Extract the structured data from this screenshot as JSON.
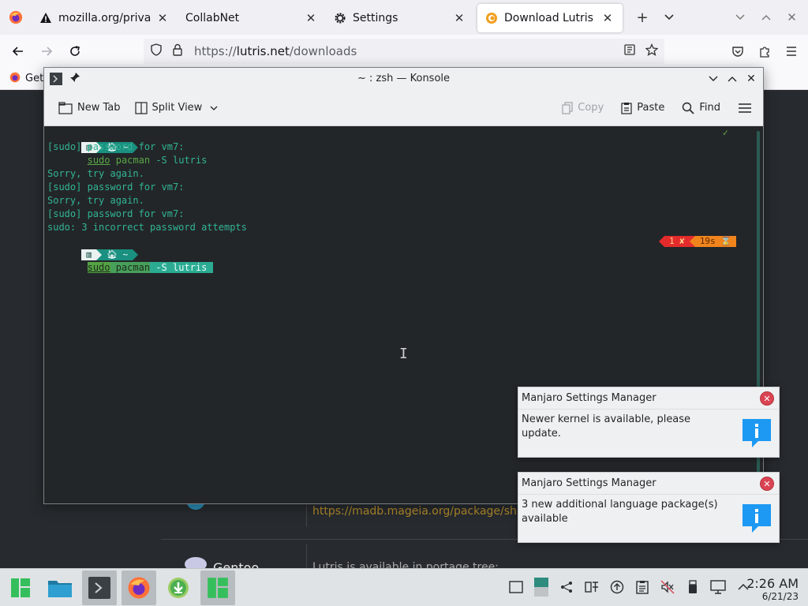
{
  "browser": {
    "tabs": [
      {
        "label": "mozilla.org/privacy/fi",
        "icon": "warning-icon"
      },
      {
        "label": "CollabNet",
        "icon": ""
      },
      {
        "label": "Settings",
        "icon": "gear-icon"
      },
      {
        "label": "Download Lutris",
        "icon": "lutris-icon",
        "active": true
      }
    ],
    "url_prefix": "https://",
    "url_host": "lutris.net",
    "url_path": "/downloads",
    "bookmark_label": "Get"
  },
  "webpage": {
    "mageia_link": "https://madb.mageia.org/package/sh",
    "gentoo_name": "Gentoo",
    "gentoo_desc": "Lutris is available in portage tree:"
  },
  "konsole": {
    "title": "~ : zsh — Konsole",
    "toolbar": {
      "new_tab": "New Tab",
      "split_view": "Split View",
      "copy": "Copy",
      "paste": "Paste",
      "find": "Find"
    },
    "terminal": {
      "cmd_sudo": "sudo",
      "cmd_pacman": "pacman",
      "cmd_rest": " -S lutris",
      "prompt_home": "~",
      "lines": [
        "[sudo] password for vm7:",
        "",
        "Sorry, try again.",
        "[sudo] password for vm7:",
        "Sorry, try again.",
        "[sudo] password for vm7:",
        "sudo: 3 incorrect password attempts"
      ],
      "rprompt_err": "1 ✘",
      "rprompt_time": "19s ⌛",
      "check": "✓"
    }
  },
  "notifications": [
    {
      "app": "Manjaro Settings Manager",
      "message": "Newer kernel is available, please update."
    },
    {
      "app": "Manjaro Settings Manager",
      "message": "3 new additional language package(s) available"
    }
  ],
  "clock": {
    "time": "2:26 AM",
    "date": "6/21/23"
  },
  "colors": {
    "manjaro_green": "#35bf5c",
    "terminal_bg": "#232629",
    "terminal_text": "#31b596",
    "error_red": "#e42b2b",
    "time_orange": "#f1841c"
  }
}
